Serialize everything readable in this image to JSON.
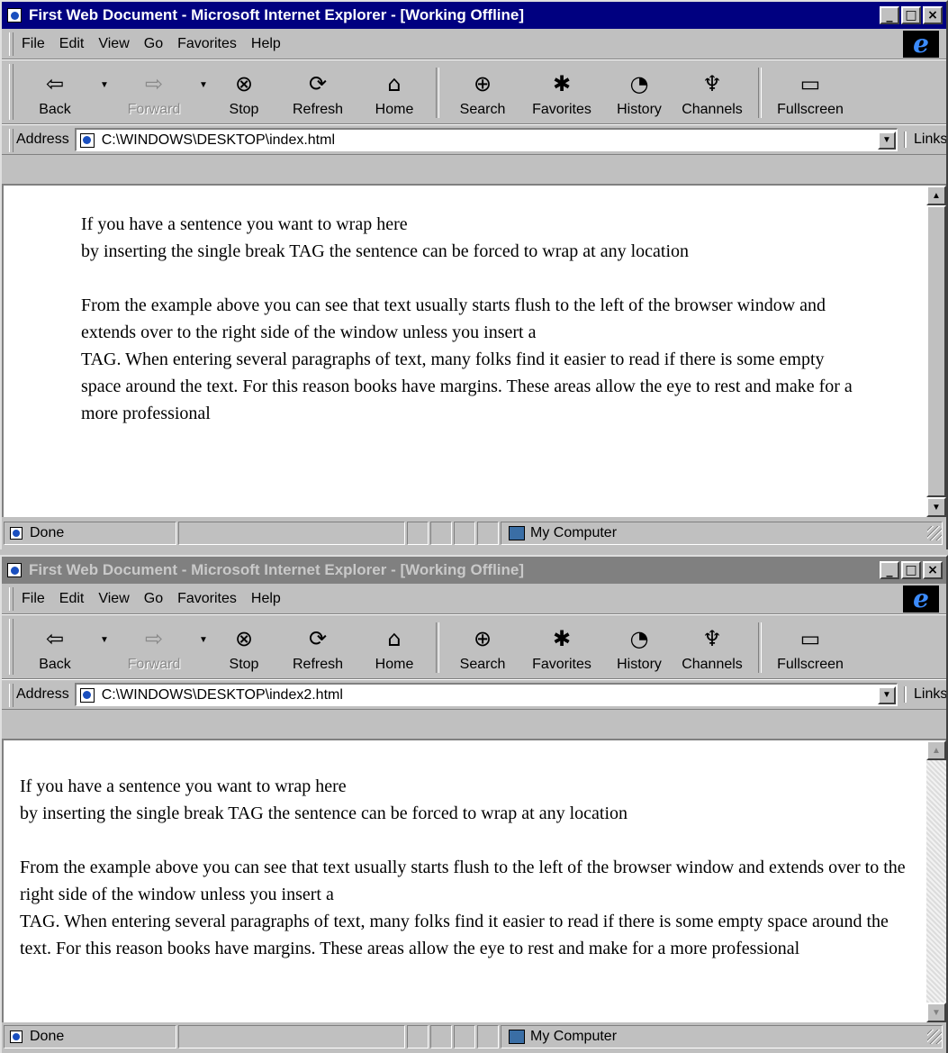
{
  "windows": [
    {
      "title": "First Web Document - Microsoft Internet Explorer - [Working Offline]",
      "active": true,
      "address_label": "Address",
      "address": "C:\\WINDOWS\\DESKTOP\\index.html",
      "links_label": "Links",
      "paragraphs": [
        [
          "If you have a sentence you want to wrap here",
          "by inserting the single break TAG the sentence can be forced to wrap at any location"
        ],
        [
          "From the example above you can see that text usually starts flush to the left of the browser window and extends over to the right side of the window unless you insert a",
          "TAG. When entering several paragraphs of text, many folks find it easier to read if there is some empty space around the text. For this reason books have margins. These areas allow the eye to rest and make for a more professional"
        ]
      ],
      "status_text": "Done",
      "zone_text": "My Computer"
    },
    {
      "title": "First Web Document - Microsoft Internet Explorer - [Working Offline]",
      "active": false,
      "address_label": "Address",
      "address": "C:\\WINDOWS\\DESKTOP\\index2.html",
      "links_label": "Links",
      "paragraphs": [
        [
          "If you have a sentence you want to wrap here",
          "by inserting the single break TAG the sentence can be forced to wrap at any location"
        ],
        [
          "From the example above you can see that text usually starts flush to the left of the browser window and extends over to the right side of the window unless you insert a",
          "TAG. When entering several paragraphs of text, many folks find it easier to read if there is some empty space around the text. For this reason books have margins. These areas allow the eye to rest and make for a more professional"
        ]
      ],
      "status_text": "Done",
      "zone_text": "My Computer"
    }
  ],
  "menu": {
    "file": "File",
    "edit": "Edit",
    "view": "View",
    "go": "Go",
    "favorites": "Favorites",
    "help": "Help"
  },
  "toolbar": {
    "back": "Back",
    "forward": "Forward",
    "stop": "Stop",
    "refresh": "Refresh",
    "home": "Home",
    "search": "Search",
    "favorites": "Favorites",
    "history": "History",
    "channels": "Channels",
    "fullscreen": "Fullscreen"
  },
  "icons": {
    "back": "back-arrow-icon",
    "forward": "forward-arrow-icon",
    "stop": "stop-icon",
    "refresh": "refresh-icon",
    "home": "home-icon",
    "search": "search-globe-icon",
    "favorites": "favorites-folder-icon",
    "history": "history-icon",
    "channels": "channels-satellite-icon",
    "fullscreen": "fullscreen-icon"
  },
  "colors": {
    "active_title": "#000080",
    "inactive_title": "#808080",
    "chrome": "#c0c0c0"
  }
}
